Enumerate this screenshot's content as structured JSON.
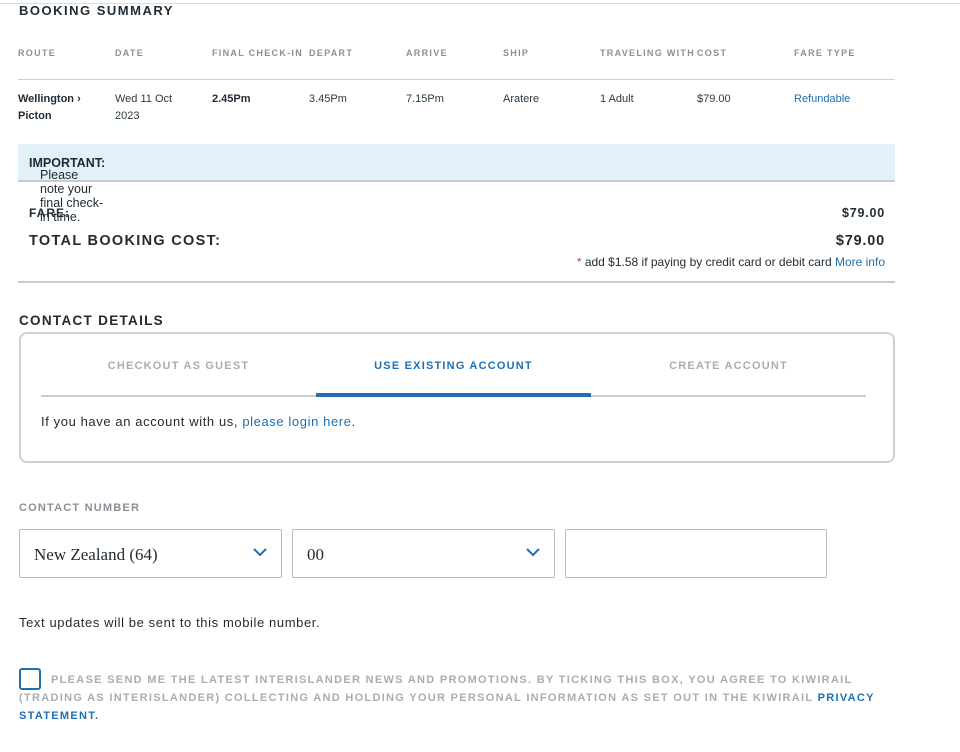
{
  "booking_summary": {
    "title": "BOOKING SUMMARY",
    "headers": {
      "route": "ROUTE",
      "date": "DATE",
      "final_checkin": "FINAL CHECK-IN",
      "depart": "DEPART",
      "arrive": "ARRIVE",
      "ship": "SHIP",
      "traveling_with": "TRAVELING WITH",
      "cost": "COST",
      "fare_type": "FARE TYPE"
    },
    "row": {
      "route_line1": "Wellington ›",
      "route_line2": "Picton",
      "date_line1": "Wed 11 Oct",
      "date_line2": "2023",
      "final_checkin": "2.45Pm",
      "depart": "3.45Pm",
      "arrive": "7.15Pm",
      "ship": "Aratere",
      "traveling_with": "1 Adult",
      "cost": "$79.00",
      "fare_type": "Refundable"
    },
    "notice_bold": "IMPORTANT:",
    "notice_text": " Please note your final check-in time.",
    "fare_label": "FARE:",
    "fare_value": "$79.00",
    "total_label": "TOTAL BOOKING COST:",
    "total_value": "$79.00",
    "surcharge_star": "*",
    "surcharge_text": " add $1.58 if paying by credit card or debit card ",
    "surcharge_link": "More info"
  },
  "contact": {
    "title": "CONTACT DETAILS",
    "tabs": [
      {
        "label": "CHECKOUT AS GUEST"
      },
      {
        "label": "USE EXISTING ACCOUNT"
      },
      {
        "label": "CREATE ACCOUNT"
      }
    ],
    "active_tab": "USE EXISTING ACCOUNT",
    "login_text": "If you have an account with us, ",
    "login_link": "please login here",
    "login_end": "."
  },
  "contact_number": {
    "label": "CONTACT NUMBER",
    "country_value": "New Zealand (64)",
    "code_value": "00",
    "phone_value": "",
    "updates_text": "Text updates will be sent to this mobile number."
  },
  "consent": {
    "text": "PLEASE SEND ME THE LATEST INTERISLANDER NEWS AND PROMOTIONS. BY TICKING THIS BOX, YOU AGREE TO KIWIRAIL (TRADING AS INTERISLANDER) COLLECTING AND HOLDING YOUR PERSONAL INFORMATION AS SET OUT IN THE KIWIRAIL ",
    "link": "PRIVACY STATEMENT",
    "end": ".",
    "checked": false
  },
  "icons": {
    "dropdown": "chevron-down-icon"
  },
  "colors": {
    "accent": "#1f6fb2",
    "notice_bg": "#e2f0f8",
    "muted": "#a9adb1"
  }
}
